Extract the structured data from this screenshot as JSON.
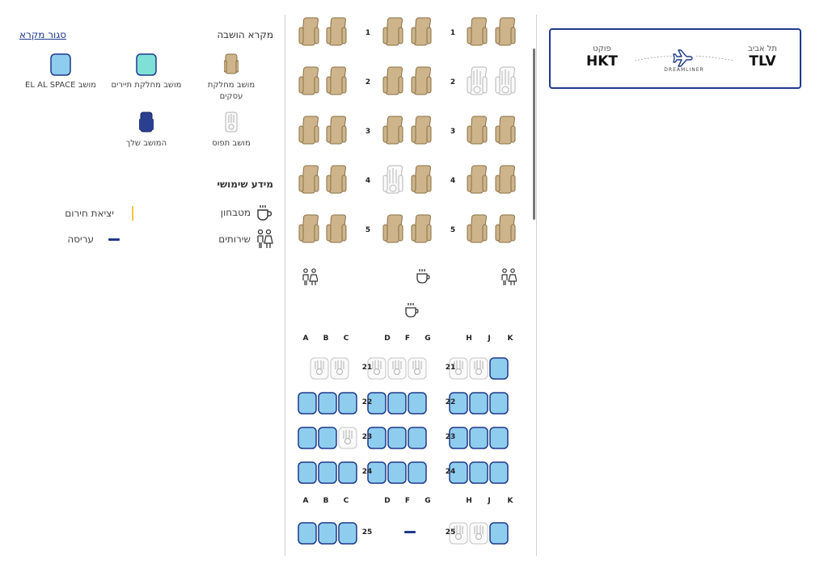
{
  "legend": {
    "title": "מקרא הושבה",
    "close_link": "סגור מקרא",
    "business_seat": "מושב מחלקת עסקים",
    "economy_seat": "מושב מחלקת תיירים",
    "space_seat": "מושב EL AL SPACE",
    "taken_seat": "מושב תפוס",
    "your_seat": "המושב שלך",
    "info_title": "מידע שימושי",
    "galley": "מטבחון",
    "exit": "יציאת חירום",
    "lavatory": "שירותים",
    "bassinet": "עריסה"
  },
  "flight": {
    "origin_city": "תל אביב",
    "origin_code": "TLV",
    "dest_city": "פוקט",
    "dest_code": "HKT",
    "aircraft_logo_text": "DREAMLINER"
  },
  "business_rows": [
    "1",
    "2",
    "3",
    "4",
    "5"
  ],
  "economy_rows": [
    "21",
    "22",
    "23",
    "24",
    "25"
  ],
  "column_letters": [
    "A",
    "B",
    "C",
    "D",
    "F",
    "G",
    "H",
    "J",
    "K"
  ],
  "seat_colors": {
    "business": "#cdb48a",
    "business_stroke": "#8a6f45",
    "space": "#8fcdef",
    "space_stroke": "#1f3a8a",
    "economy": "#7ee0d6",
    "your_seat": "#2a3f8f",
    "exit": "#f3c53c",
    "bassinet": "#1f3a8a"
  }
}
